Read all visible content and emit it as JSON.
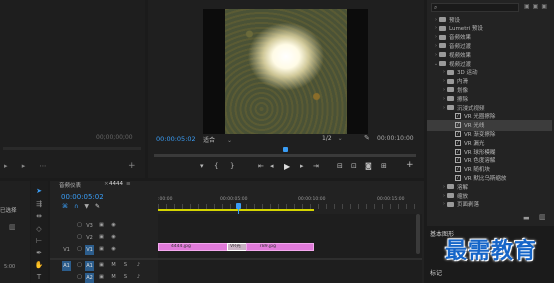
{
  "source_monitor": {
    "timecode": "00;00;00;00"
  },
  "program_monitor": {
    "timecode_left": "00:00:05:02",
    "fit_label": "适合",
    "scale_label": "1/2",
    "timecode_right": "00:00:10:00"
  },
  "effects_panel": {
    "search_placeholder": "",
    "items": [
      {
        "label": "预设",
        "indent": 1,
        "type": "folder",
        "expanded": false
      },
      {
        "label": "Lumetri 预设",
        "indent": 1,
        "type": "folder",
        "expanded": false
      },
      {
        "label": "音频效果",
        "indent": 1,
        "type": "folder",
        "expanded": false
      },
      {
        "label": "音频过渡",
        "indent": 1,
        "type": "folder",
        "expanded": false
      },
      {
        "label": "视频效果",
        "indent": 1,
        "type": "folder",
        "expanded": false
      },
      {
        "label": "视频过渡",
        "indent": 1,
        "type": "folder",
        "expanded": true
      },
      {
        "label": "3D 运动",
        "indent": 2,
        "type": "folder",
        "expanded": false
      },
      {
        "label": "内滑",
        "indent": 2,
        "type": "folder",
        "expanded": false
      },
      {
        "label": "划像",
        "indent": 2,
        "type": "folder",
        "expanded": false
      },
      {
        "label": "擦除",
        "indent": 2,
        "type": "folder",
        "expanded": false
      },
      {
        "label": "沉浸式视频",
        "indent": 2,
        "type": "folder",
        "expanded": false
      },
      {
        "label": "VR 光圈擦除",
        "indent": 3,
        "type": "effect"
      },
      {
        "label": "VR 光线",
        "indent": 3,
        "type": "effect",
        "selected": true
      },
      {
        "label": "VR 渐变擦除",
        "indent": 3,
        "type": "effect"
      },
      {
        "label": "VR 漏光",
        "indent": 3,
        "type": "effect"
      },
      {
        "label": "VR 球形模糊",
        "indent": 3,
        "type": "effect"
      },
      {
        "label": "VR 色度溶解",
        "indent": 3,
        "type": "effect"
      },
      {
        "label": "VR 随机块",
        "indent": 3,
        "type": "effect"
      },
      {
        "label": "VR 默比乌斯缩放",
        "indent": 3,
        "type": "effect"
      },
      {
        "label": "溶解",
        "indent": 2,
        "type": "folder",
        "expanded": false
      },
      {
        "label": "缩放",
        "indent": 2,
        "type": "folder",
        "expanded": false
      },
      {
        "label": "页面剥落",
        "indent": 2,
        "type": "folder",
        "expanded": false
      }
    ],
    "bottom_tab_1": "基本图形",
    "bottom_tab_2": "标记"
  },
  "project_panel": {
    "label_selected": "已选择",
    "label_duration": "5:00"
  },
  "timeline": {
    "tab_audio": "音频仪表",
    "tab_sequence": "4444",
    "timecode": "00:00:05:02",
    "ruler": [
      ":00:00",
      "00:00:05:00",
      "00:00:10:00",
      "00:00:15:00"
    ],
    "tracks_video": [
      "V3",
      "V2",
      "V1"
    ],
    "tracks_audio": [
      "A1",
      "A2"
    ],
    "clip_1": "4444.jpg",
    "clip_2": "VR光",
    "clip_3": "789.jpg"
  },
  "watermark": "最需教育",
  "colors": {
    "accent": "#3a9df5",
    "clip": "#e07ad9",
    "work_area": "#d4d400"
  }
}
